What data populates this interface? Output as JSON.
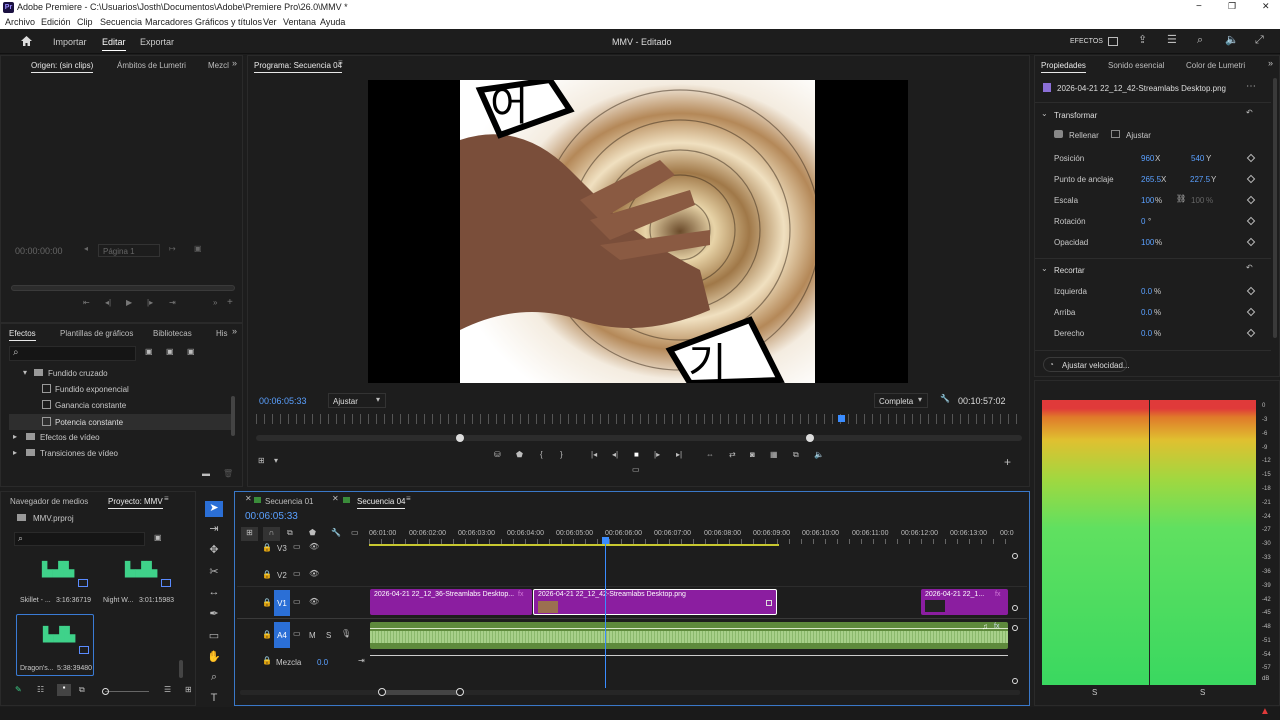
{
  "window": {
    "title": "Adobe Premiere - C:\\Usuarios\\Josth\\Documentos\\Adobe\\Premiere Pro\\26.0\\MMV *",
    "app_badge": "Pr",
    "min": "−",
    "max": "❐",
    "close": "✕"
  },
  "menu": [
    "Archivo",
    "Edición",
    "Clip",
    "Secuencia",
    "Marcadores",
    "Gráficos y títulos",
    "Ver",
    "Ventana",
    "Ayuda"
  ],
  "topnav": {
    "tabs": [
      "Importar",
      "Editar",
      "Exportar"
    ],
    "active_tab": "Editar",
    "project_title": "MMV - Editado",
    "effects_label": "EFECTOS"
  },
  "source": {
    "tabs": [
      "Origen: (sin clips)",
      "Ámbitos de Lumetri",
      "Mezcl"
    ],
    "timecode": "00:00:00:00",
    "page": "Página 1"
  },
  "program": {
    "tab": "Programa: Secuencia 04",
    "timecode_in": "00:06:05:33",
    "fit": "Ajustar",
    "quality": "Completa",
    "timecode_dur": "00:10:57:02",
    "image_texts": [
      "어",
      "기"
    ]
  },
  "effects_panel": {
    "tabs": [
      "Efectos",
      "Plantillas de gráficos",
      "Bibliotecas",
      "His"
    ],
    "tree": [
      {
        "label": "Fundido cruzado",
        "level": 1,
        "type": "folder",
        "open": true
      },
      {
        "label": "Fundido exponencial",
        "level": 2,
        "type": "effect"
      },
      {
        "label": "Ganancia constante",
        "level": 2,
        "type": "effect"
      },
      {
        "label": "Potencia constante",
        "level": 2,
        "type": "effect",
        "selected": true
      },
      {
        "label": "Efectos de vídeo",
        "level": 0,
        "type": "folder"
      },
      {
        "label": "Transiciones de vídeo",
        "level": 0,
        "type": "folder"
      }
    ]
  },
  "project_panel": {
    "tabs": [
      "Navegador de medios",
      "Proyecto: MMV"
    ],
    "project_file": "MMV.prproj",
    "items": [
      {
        "name": "Skillet - ...",
        "duration": "3:16:36719"
      },
      {
        "name": "Night W...",
        "duration": "3:01:15983"
      },
      {
        "name": "Dragon's...",
        "duration": "5:38:39480"
      }
    ]
  },
  "timeline": {
    "tabs": [
      "Secuencia 01",
      "Secuencia 04"
    ],
    "timecode": "00:06:05:33",
    "ruler": [
      "06:01:00",
      "00:06:02:00",
      "00:06:03:00",
      "00:06:04:00",
      "00:06:05:00",
      "00:06:06:00",
      "00:06:07:00",
      "00:06:08:00",
      "00:06:09:00",
      "00:06:10:00",
      "00:06:11:00",
      "00:06:12:00",
      "00:06:13:00",
      "00:0"
    ],
    "tracks": [
      "V3",
      "V2",
      "V1",
      "A4"
    ],
    "mix_label": "Mezcla",
    "mix_value": "0.0",
    "clips": [
      "2026-04-21 22_12_36-Streamlabs Desktop...",
      "2026-04-21 22_12_42-Streamlabs Desktop.png",
      "2026-04-21 22_1..."
    ],
    "track_btns": {
      "m": "M",
      "s": "S"
    }
  },
  "properties": {
    "tabs": [
      "Propiedades",
      "Sonido esencial",
      "Color de Lumetri"
    ],
    "file": "2026-04-21 22_12_42-Streamlabs Desktop.png",
    "transform_title": "Transformar",
    "fill": "Rellenar",
    "fit": "Ajustar",
    "rows": [
      {
        "label": "Posición",
        "v1": "960",
        "u1": "X",
        "v2": "540",
        "u2": "Y"
      },
      {
        "label": "Punto de anclaje",
        "v1": "265.5",
        "u1": "X",
        "v2": "227.5",
        "u2": "Y"
      },
      {
        "label": "Escala",
        "v1": "100",
        "u1": "%",
        "v2": "100",
        "u2": "%"
      },
      {
        "label": "Rotación",
        "v1": "0",
        "u1": "°",
        "v2": "",
        "u2": ""
      },
      {
        "label": "Opacidad",
        "v1": "100",
        "u1": "%",
        "v2": "",
        "u2": ""
      }
    ],
    "crop_title": "Recortar",
    "crop_rows": [
      {
        "label": "Izquierda",
        "v": "0.0",
        "u": "%"
      },
      {
        "label": "Arriba",
        "v": "0.0",
        "u": "%"
      },
      {
        "label": "Derecho",
        "v": "0.0",
        "u": "%"
      }
    ],
    "speed_btn": "Ajustar velocidad..."
  },
  "meter": {
    "ticks": [
      "0",
      "-3",
      "-6",
      "-9",
      "-12",
      "-15",
      "-18",
      "-21",
      "-24",
      "-27",
      "-30",
      "-33",
      "-36",
      "-39",
      "-42",
      "-45",
      "-48",
      "-51",
      "-54",
      "-57",
      "dB"
    ],
    "channels": [
      "S",
      "S"
    ]
  },
  "colors": {
    "accent": "#2b7de9",
    "clip": "#8b1ea0",
    "audio": "#5a8a3a",
    "playhead": "#3a8cff"
  }
}
